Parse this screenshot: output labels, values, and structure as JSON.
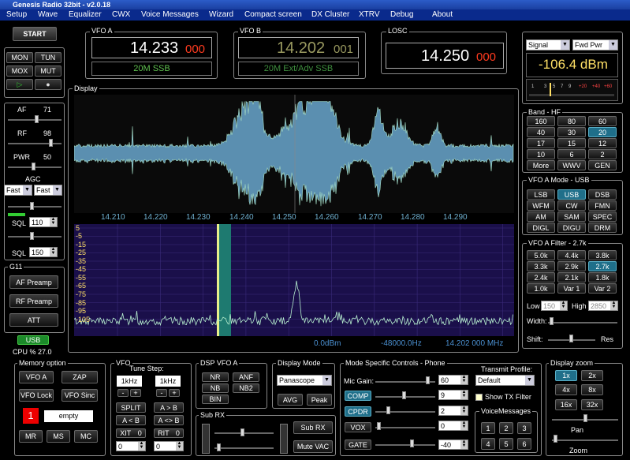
{
  "app": {
    "title": "Genesis Radio 32bit - v2.0.18"
  },
  "menu": [
    "Setup",
    "Wave",
    "Equalizer",
    "CWX",
    "Voice Messages",
    "Wizard",
    "Compact screen",
    "DX Cluster",
    "XTRV",
    "Debug",
    "About"
  ],
  "power": {
    "start": "START",
    "mon": "MON",
    "tun": "TUN",
    "mox": "MOX",
    "mut": "MUT"
  },
  "vfoa": {
    "title": "VFO A",
    "freq": "14.233",
    "sub": "000",
    "band": "20M SSB"
  },
  "vfob": {
    "title": "VFO B",
    "freq": "14.202",
    "sub": "001",
    "band": "20M Ext/Adv SSB"
  },
  "losc": {
    "title": "LOSC",
    "freq": "14.250",
    "sub": "000"
  },
  "meter": {
    "sel1": "Signal",
    "sel2": "Fwd Pwr",
    "reading": "-106.4 dBm",
    "scale": [
      "1",
      "3",
      "5",
      "7",
      "9",
      "+20",
      "+40",
      "+60"
    ]
  },
  "display": {
    "title": "Display",
    "freq_axis": [
      "14.210",
      "14.220",
      "14.230",
      "14.240",
      "14.250",
      "14.260",
      "14.270",
      "14.280",
      "14.290"
    ],
    "db_axis": [
      "5",
      "-5",
      "-15",
      "-25",
      "-35",
      "-45",
      "-55",
      "-65",
      "-75",
      "-85",
      "-95",
      "-105"
    ],
    "status": {
      "dbm": "0.0dBm",
      "hz": "-48000.0Hz",
      "mhz": "14.202 000 MHz"
    }
  },
  "left": {
    "af": "AF",
    "af_val": "71",
    "rf": "RF",
    "rf_val": "98",
    "pwr": "PWR",
    "pwr_val": "50",
    "agc": "AGC",
    "agc1": "Fast",
    "agc2": "Fast",
    "sql": "SQL",
    "sql1": "110",
    "sql2": "150"
  },
  "g11": {
    "title": "G11",
    "af": "AF Preamp",
    "rf": "RF Preamp",
    "att": "ATT",
    "usb": "USB",
    "cpu": "CPU % 27.0"
  },
  "band": {
    "title": "Band - HF",
    "items": [
      "160",
      "80",
      "60",
      "40",
      "30",
      "20",
      "17",
      "15",
      "12",
      "10",
      "6",
      "2",
      "More",
      "WWV",
      "GEN"
    ]
  },
  "mode": {
    "title": "VFO A Mode - USB",
    "items": [
      "LSB",
      "USB",
      "DSB",
      "WFM",
      "CW",
      "FMN",
      "AM",
      "SAM",
      "SPEC",
      "DIGL",
      "DIGU",
      "DRM"
    ]
  },
  "filter": {
    "title": "VFO A Filter - 2.7k",
    "items": [
      "5.0k",
      "4.4k",
      "3.8k",
      "3.3k",
      "2.9k",
      "2.7k",
      "2.4k",
      "2.1k",
      "1.8k",
      "1.0k",
      "Var 1",
      "Var 2"
    ],
    "low": "Low",
    "low_val": "150",
    "high": "High",
    "high_val": "2850",
    "width": "Width:",
    "shift": "Shift:",
    "res": "Res"
  },
  "memory": {
    "title": "Memory option",
    "vfoa": "VFO A",
    "zap": "ZAP",
    "lock": "VFO Lock",
    "sinc": "VFO Sinc",
    "num": "1",
    "empty": "empty",
    "mr": "MR",
    "ms": "MS",
    "mc": "MC"
  },
  "vfo": {
    "title": "VFO",
    "tunestep": "Tune Step:",
    "step1": "1kHz",
    "step2": "1kHz",
    "minus": "-",
    "plus": "+",
    "split": "SPLIT",
    "ab": "A > B",
    "ba": "A < B",
    "aswap": "A <> B",
    "xit": "XIT",
    "xit_val": "0",
    "rit": "RIT",
    "rit_val": "0",
    "spin1": "0",
    "spin2": "0"
  },
  "dsp": {
    "title": "DSP VFO A",
    "nr": "NR",
    "anf": "ANF",
    "nb": "NB",
    "nb2": "NB2",
    "bin": "BIN"
  },
  "subrx": {
    "title": "Sub RX",
    "btn": "Sub RX",
    "mute": "Mute VAC"
  },
  "dispmode": {
    "title": "Display Mode",
    "value": "Panascope",
    "avg": "AVG",
    "peak": "Peak"
  },
  "modespec": {
    "title": "Mode Specific Controls - Phone",
    "mic": "Mic Gain:",
    "mic_val": "60",
    "comp": "COMP",
    "comp_val": "9",
    "cpdr": "CPDR",
    "cpdr_val": "2",
    "vox": "VOX",
    "vox_val": "0",
    "gate": "GATE",
    "gate_val": "-40",
    "txprofile": "Transmit Profile:",
    "profile": "Default",
    "showtx": "Show TX Filter",
    "voicemsg": "VoiceMessages",
    "vm": [
      "1",
      "2",
      "3",
      "4",
      "5",
      "6"
    ]
  },
  "zoom": {
    "title": "Display zoom",
    "items": [
      "1x",
      "2x",
      "4x",
      "8x",
      "16x",
      "32x"
    ],
    "pan": "Pan",
    "zoom": "Zoom"
  },
  "colors": {
    "accent": "#1f6f8a",
    "vfo_green": "#5fbf4f",
    "red": "#ff3b1f",
    "yellow": "#ffe066"
  }
}
